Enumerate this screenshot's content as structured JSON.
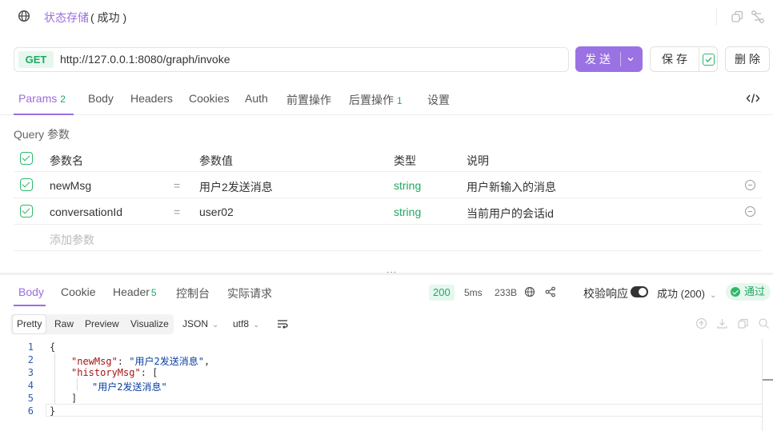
{
  "header": {
    "title": "状态存储",
    "status": "( 成功 )"
  },
  "request": {
    "method": "GET",
    "url": "http://127.0.0.1:8080/graph/invoke",
    "send_label": "发送",
    "save_label": "保存",
    "delete_label": "删除"
  },
  "req_tabs": [
    {
      "label": "Params",
      "badge": "2"
    },
    {
      "label": "Body",
      "badge": ""
    },
    {
      "label": "Headers",
      "badge": ""
    },
    {
      "label": "Cookies",
      "badge": ""
    },
    {
      "label": "Auth",
      "badge": ""
    },
    {
      "label": "前置操作",
      "badge": ""
    },
    {
      "label": "后置操作",
      "badge": "1"
    },
    {
      "label": "设置",
      "badge": ""
    }
  ],
  "query": {
    "title": "Query 参数",
    "columns": [
      "参数名",
      "参数值",
      "类型",
      "说明"
    ],
    "rows": [
      {
        "name": "newMsg",
        "value": "用户2发送消息",
        "type": "string",
        "desc": "用户新输入的消息"
      },
      {
        "name": "conversationId",
        "value": "user02",
        "type": "string",
        "desc": "当前用户的会话id"
      }
    ],
    "add_placeholder": "添加参数"
  },
  "response": {
    "tabs": [
      {
        "label": "Body",
        "badge": ""
      },
      {
        "label": "Cookie",
        "badge": ""
      },
      {
        "label": "Header",
        "badge": "5"
      },
      {
        "label": "控制台",
        "badge": ""
      },
      {
        "label": "实际请求",
        "badge": ""
      }
    ],
    "status_code": "200",
    "time": "5ms",
    "size": "233B",
    "validate_label": "校验响应",
    "result_select": "成功 (200)",
    "pass_label": "通过",
    "formats": [
      "Pretty",
      "Raw",
      "Preview",
      "Visualize"
    ],
    "format_type": "JSON",
    "encoding": "utf8"
  },
  "code": {
    "line_numbers": [
      "1",
      "2",
      "3",
      "4",
      "5",
      "6"
    ],
    "brace_open": "{",
    "key_newMsg": "\"newMsg\"",
    "val_newMsg": "\"用户2发送消息\"",
    "key_history": "\"historyMsg\"",
    "history_item": "\"用户2发送消息\"",
    "bracket_close": "]",
    "brace_close": "}"
  },
  "colors": {
    "accent": "#9b72e3",
    "success": "#22a862"
  }
}
